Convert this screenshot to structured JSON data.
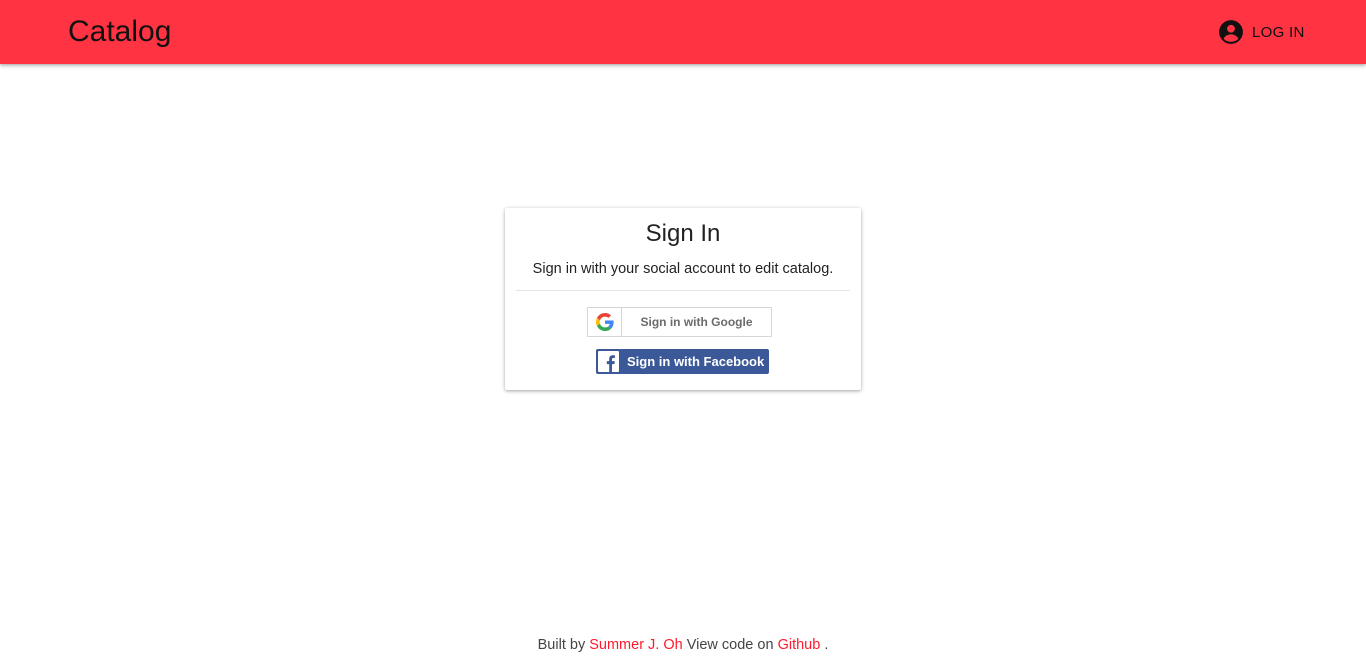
{
  "header": {
    "title": "Catalog",
    "login_label": "LOG IN",
    "login_icon": "account-circle-icon"
  },
  "signin_card": {
    "title": "Sign In",
    "subtitle": "Sign in with your social account to edit catalog.",
    "google_button_label": "Sign in with Google",
    "google_icon": "google-icon",
    "facebook_button_label": "Sign in with Facebook",
    "facebook_icon": "facebook-icon"
  },
  "footer": {
    "built_by_text": "Built by",
    "author_link": "Summer J. Oh",
    "view_code_text": "View code on",
    "github_link": "Github",
    "end_text": "."
  },
  "colors": {
    "appbar": "#ff3342",
    "link": "#ff1a2c",
    "facebook": "#3b5998"
  }
}
